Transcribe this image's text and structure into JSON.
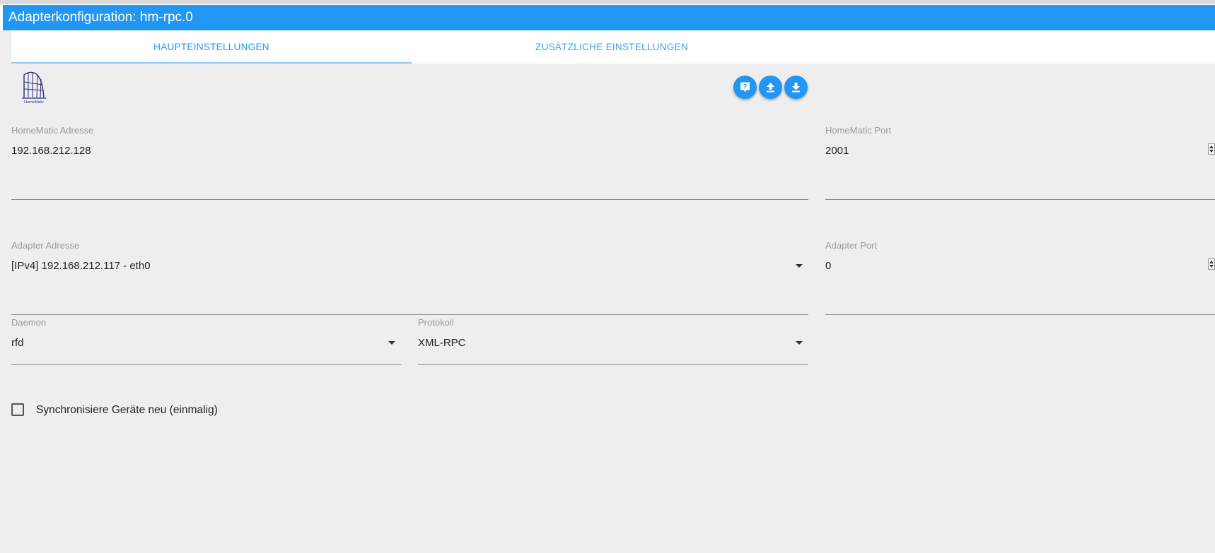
{
  "window": {
    "title": "Adapterkonfiguration: hm-rpc.0",
    "accent_color": "#2196f3",
    "background_color": "#eeeeee"
  },
  "tabs": [
    {
      "label": "HAUPTEINSTELLUNGEN",
      "active": true
    },
    {
      "label": "ZUSÄTZLICHE EINSTELLUNGEN",
      "active": false
    }
  ],
  "logo": {
    "text": "HomeMatic",
    "icon": "homematic-logo"
  },
  "toolbar": {
    "help_icon": "help-icon",
    "upload_icon": "upload-icon",
    "download_icon": "download-icon"
  },
  "fields": {
    "homematic_address": {
      "label": "HomeMatic Adresse",
      "value": "192.168.212.128"
    },
    "homematic_port": {
      "label": "HomeMatic Port",
      "value": "2001"
    },
    "adapter_address": {
      "label": "Adapter Adresse",
      "value": "[IPv4] 192.168.212.117 - eth0"
    },
    "adapter_port": {
      "label": "Adapter Port",
      "value": "0"
    },
    "daemon": {
      "label": "Daemon",
      "value": "rfd"
    },
    "protocol": {
      "label": "Protokoll",
      "value": "XML-RPC"
    }
  },
  "sync": {
    "label": "Synchronisiere Geräte neu (einmalig)",
    "checked": false
  }
}
